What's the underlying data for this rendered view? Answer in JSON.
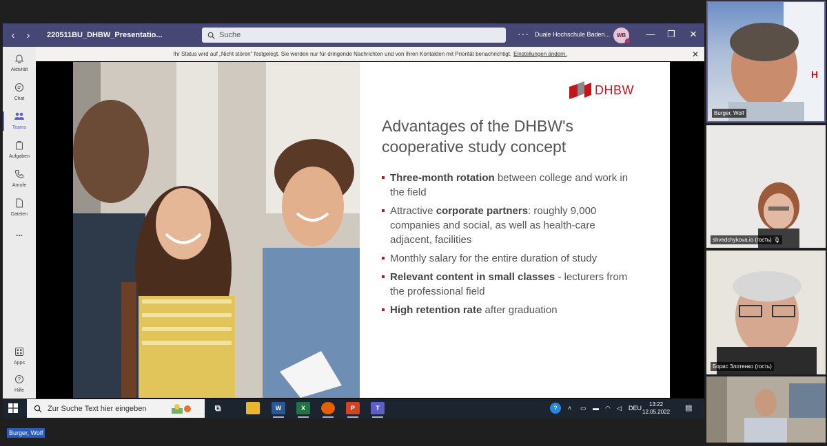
{
  "window": {
    "title": "220511BU_DHBW_Presentatio...",
    "search_placeholder": "Suche",
    "more": "···",
    "org": "Duale Hochschule Baden...",
    "avatar_initials": "WB"
  },
  "rail": {
    "items": [
      {
        "label": "Aktivität",
        "icon": "bell-icon"
      },
      {
        "label": "Chat",
        "icon": "chat-icon"
      },
      {
        "label": "Teams",
        "icon": "teams-icon"
      },
      {
        "label": "Aufgaben",
        "icon": "assignments-icon"
      },
      {
        "label": "Anrufe",
        "icon": "phone-icon"
      },
      {
        "label": "Dateien",
        "icon": "file-icon"
      },
      {
        "label": "...",
        "icon": "more-icon"
      }
    ],
    "bottom": [
      {
        "label": "Apps",
        "icon": "apps-icon"
      },
      {
        "label": "Hilfe",
        "icon": "help-icon"
      }
    ]
  },
  "banner": {
    "text": "Ihr Status wird auf „Nicht stören\" festgelegt. Sie werden nur für dringende Nachrichten und von Ihren Kontakten mit Priorität benachrichtigt.",
    "link": "Einstellungen ändern."
  },
  "slide": {
    "logo_text": "DHBW",
    "title": "Advantages of the DHBW's cooperative study concept",
    "bullets": [
      {
        "bold": "Three-month rotation",
        "rest": " between college and work in the field"
      },
      {
        "pre": "Attractive ",
        "bold": "corporate partners",
        "rest": ": roughly 9,000 companies and social, as well as health-care adjacent, facilities"
      },
      {
        "rest": "Monthly salary for the entire duration of study"
      },
      {
        "bold": "Relevant content in small classes",
        "rest": " - lecturers from the professional field"
      },
      {
        "bold": "High retention rate",
        "rest": " after graduation"
      }
    ]
  },
  "taskbar": {
    "search_placeholder": "Zur Suche Text hier eingeben",
    "lang": "DEU",
    "time": "13:22",
    "date": "12.05.2022"
  },
  "presenter_label": "Burger, Wolf",
  "participants": [
    {
      "name": "Burger, Wolf",
      "active": true
    },
    {
      "name": "shvedchykova.io (гость)",
      "muted": true
    },
    {
      "name": "Борис Злотенко (гость)"
    },
    {
      "name": ""
    }
  ],
  "colors": {
    "teams_bar": "#464775",
    "teams_accent": "#5b5fc7",
    "dhbw_red": "#c3161c"
  }
}
